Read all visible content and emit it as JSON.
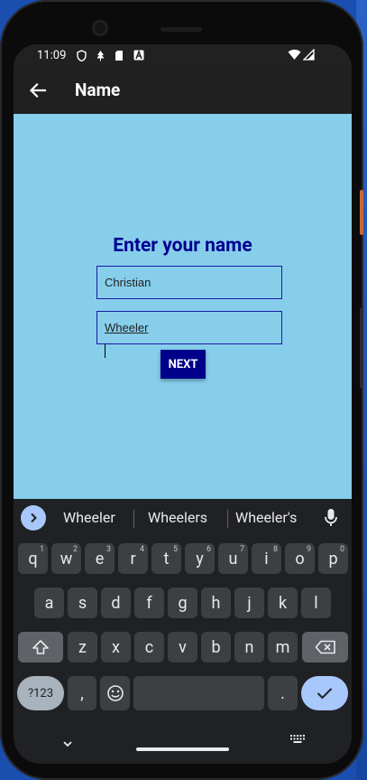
{
  "status": {
    "time": "11:09"
  },
  "appbar": {
    "title": "Name"
  },
  "form": {
    "heading": "Enter your name",
    "first_name": "Christian",
    "last_name": "Wheeler",
    "next_label": "NEXT"
  },
  "keyboard": {
    "suggestions": [
      "Wheeler",
      "Wheelers",
      "Wheeler's"
    ],
    "row1": [
      "q",
      "w",
      "e",
      "r",
      "t",
      "y",
      "u",
      "i",
      "o",
      "p"
    ],
    "row1_hints": [
      "1",
      "2",
      "3",
      "4",
      "5",
      "6",
      "7",
      "8",
      "9",
      "0"
    ],
    "row2": [
      "a",
      "s",
      "d",
      "f",
      "g",
      "h",
      "j",
      "k",
      "l"
    ],
    "row3": [
      "z",
      "x",
      "c",
      "v",
      "b",
      "n",
      "m"
    ],
    "symbols_label": "?123",
    "comma_label": ",",
    "period_label": "."
  },
  "colors": {
    "content_bg": "#87ceeb",
    "heading": "#000090",
    "next_button": "#00008b",
    "keyboard_accent": "#a8c7fa"
  }
}
